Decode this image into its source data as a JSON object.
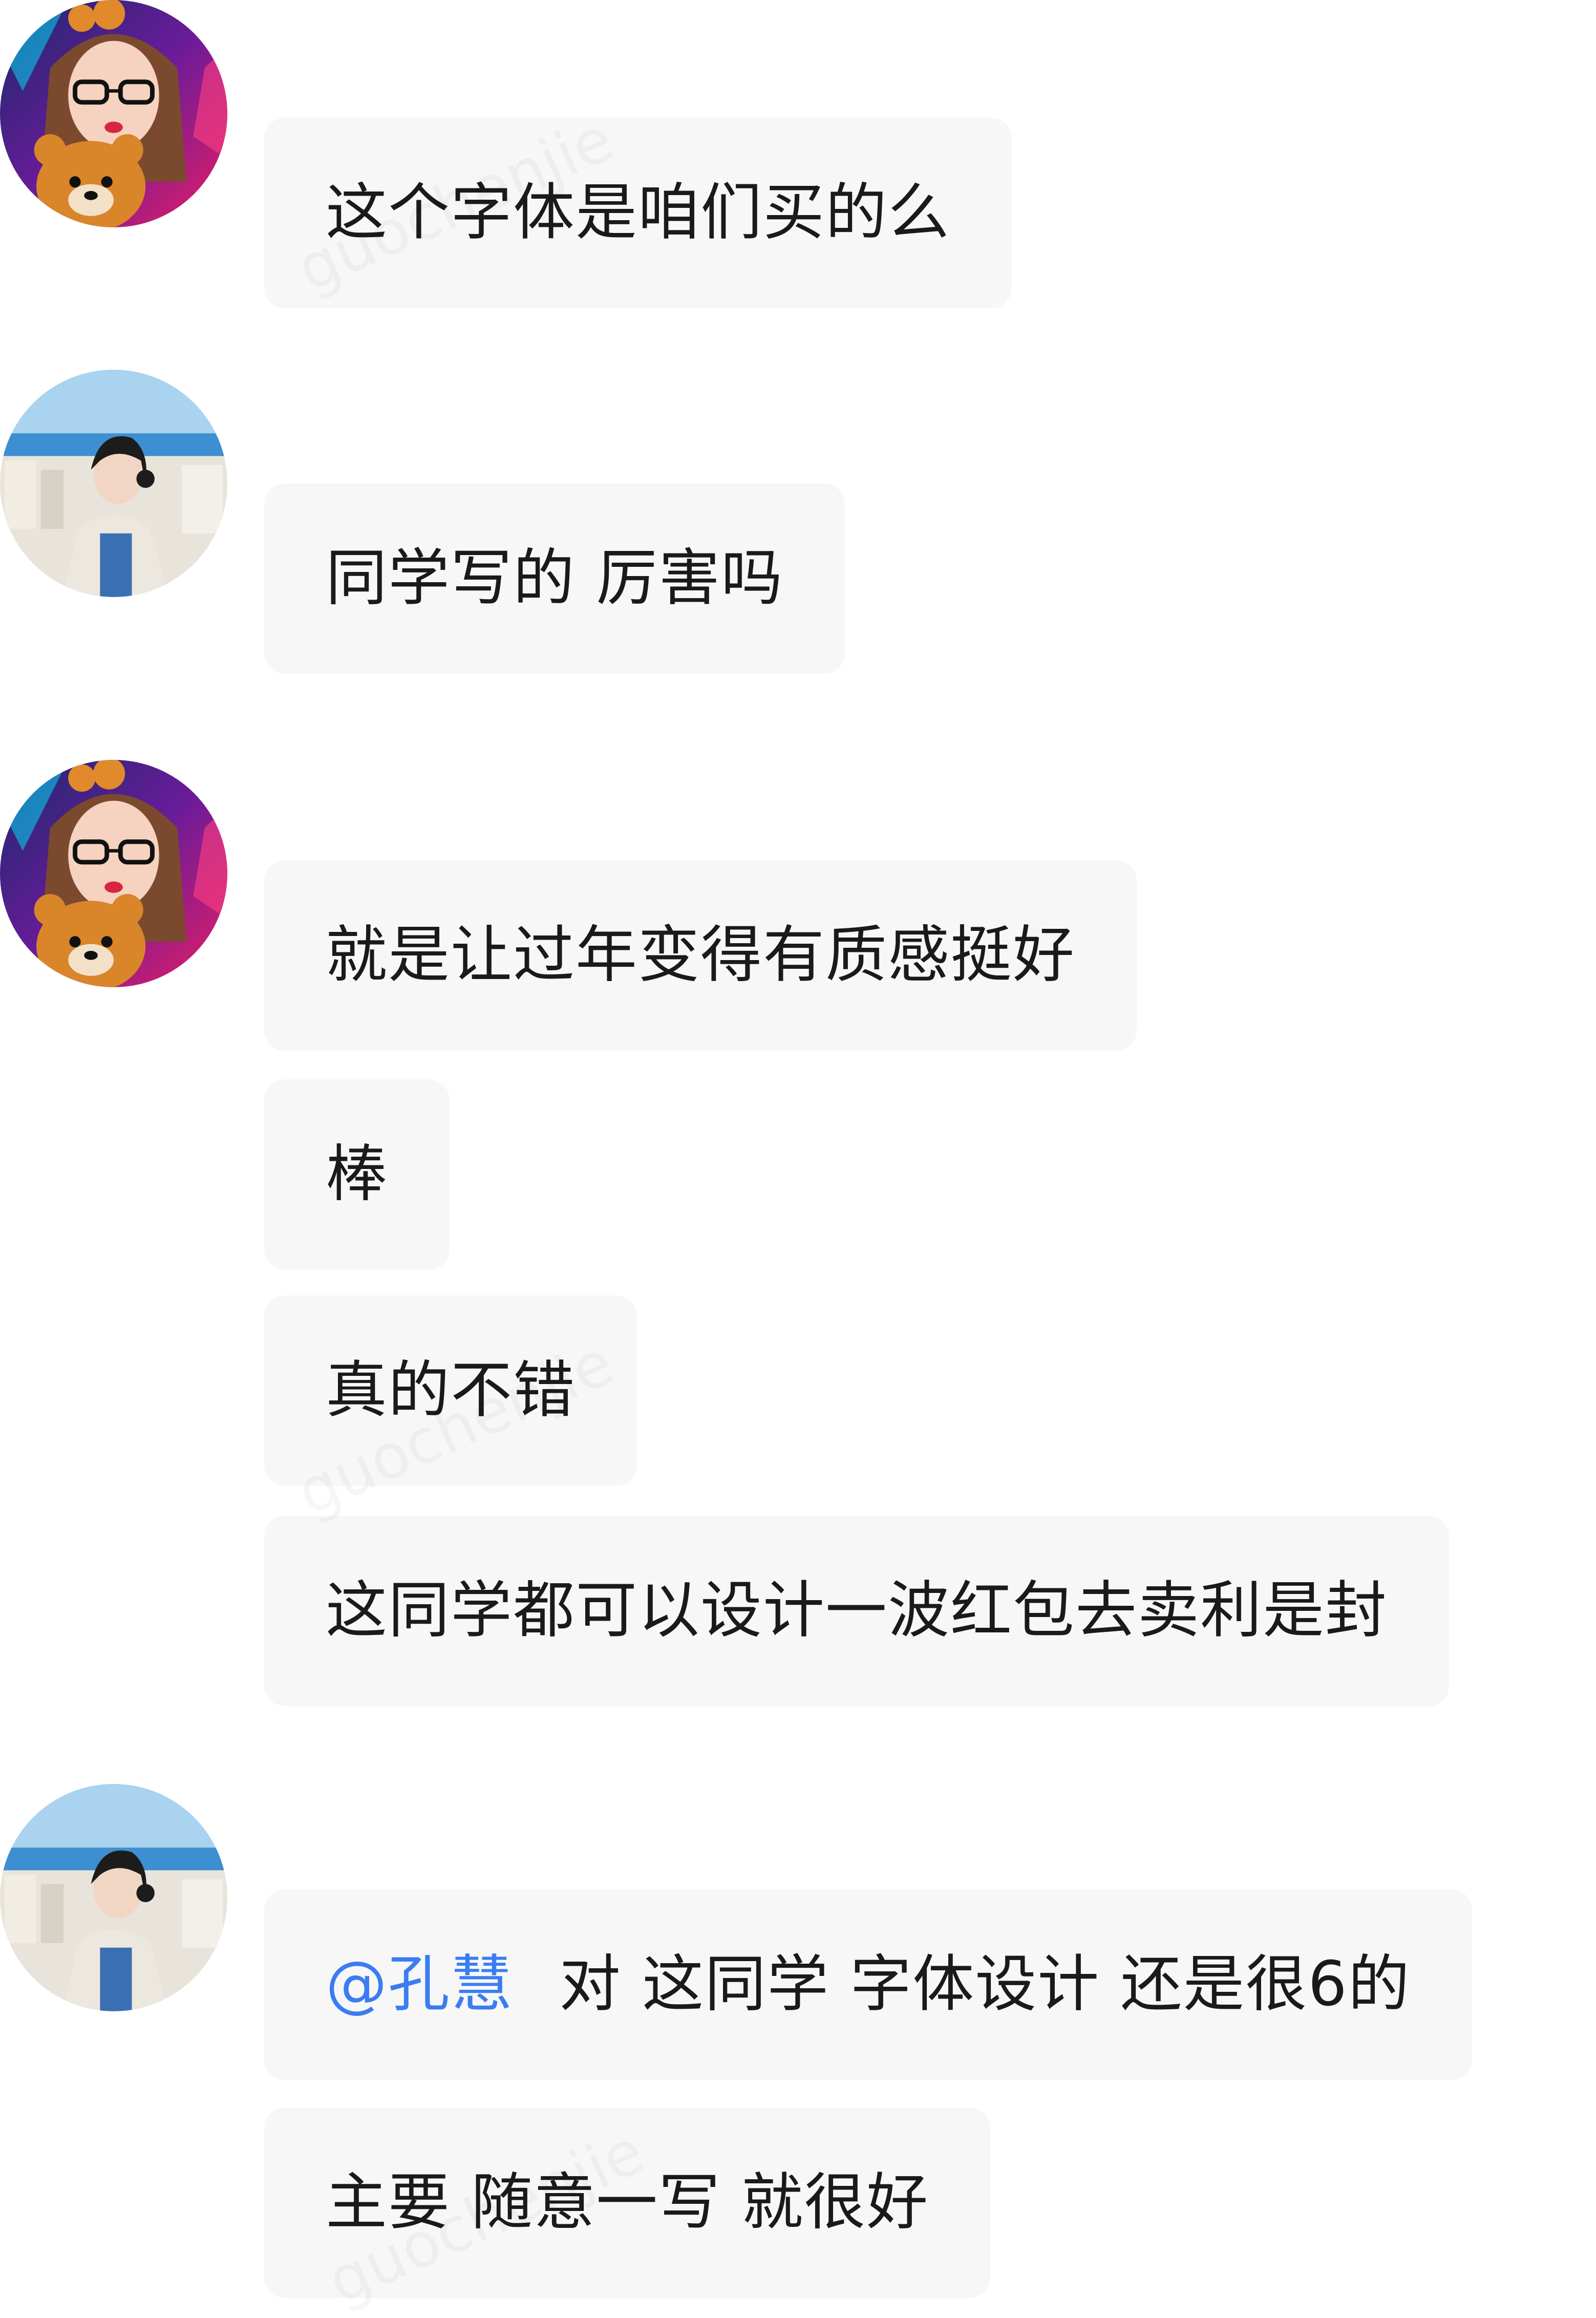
{
  "messages": [
    {
      "sender": "anime-girl",
      "text": "这个字体是咱们买的么"
    },
    {
      "sender": "beach-girl",
      "text": "同学写的  厉害吗"
    },
    {
      "sender": "anime-girl",
      "text": "就是让过年变得有质感挺好"
    },
    {
      "sender": "anime-girl",
      "text": "棒"
    },
    {
      "sender": "anime-girl",
      "text": "真的不错"
    },
    {
      "sender": "anime-girl",
      "text": "这同学都可以设计一波红包去卖利是封"
    },
    {
      "sender": "beach-girl",
      "mention": "@孔慧",
      "text": "对 这同学 字体设计 还是很6的"
    },
    {
      "sender": "beach-girl",
      "text": "主要 随意一写 就很好"
    }
  ],
  "watermark": "guochenjie",
  "colors": {
    "bubble_bg": "#f7f7f8",
    "text": "#1a1a1a",
    "mention": "#3b7df0",
    "background": "#ffffff"
  }
}
